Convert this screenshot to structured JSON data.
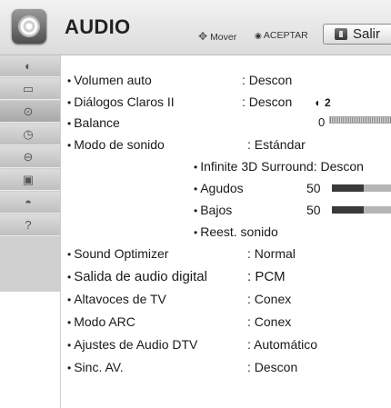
{
  "header": {
    "title": "AUDIO",
    "move_hint": "Mover",
    "ok_hint": "ACEPTAR",
    "exit_label": "Salir",
    "move_icon": "four-way-arrows-icon",
    "ok_icon": "ok-dot-icon",
    "exit_icon": "exit-icon"
  },
  "sidebar": {
    "items": [
      {
        "icon": "picture-disc-icon"
      },
      {
        "icon": "tv-icon"
      },
      {
        "icon": "audio-disc-icon",
        "active": true
      },
      {
        "icon": "clock-icon"
      },
      {
        "icon": "lock-icon"
      },
      {
        "icon": "options-icon"
      },
      {
        "icon": "network-icon"
      },
      {
        "icon": "help-icon"
      }
    ]
  },
  "settings": {
    "volumen_auto": {
      "label": "Volumen auto",
      "value": ": Descon"
    },
    "dialogos": {
      "label": "Diálogos Claros II",
      "value": ": Descon",
      "level": "2"
    },
    "balance": {
      "label": "Balance",
      "value": "0"
    },
    "modo_sonido": {
      "label": "Modo de sonido",
      "value": ": Estándar"
    },
    "infinite": {
      "label": "Infinite 3D Surround: Descon"
    },
    "agudos": {
      "label": "Agudos",
      "value": "50",
      "level": 0.5
    },
    "bajos": {
      "label": "Bajos",
      "value": "50",
      "level": 0.5
    },
    "reest": {
      "label": "Reest. sonido"
    },
    "sound_optimizer": {
      "label": "Sound Optimizer",
      "value": ": Normal"
    },
    "salida_digital": {
      "label": "Salida de audio digital",
      "value": ": PCM"
    },
    "altavoces": {
      "label": "Altavoces de TV",
      "value": ": Conex"
    },
    "modo_arc": {
      "label": "Modo ARC",
      "value": ": Conex"
    },
    "ajustes_dtv": {
      "label": "Ajustes de Audio DTV",
      "value": ": Automático"
    },
    "sinc_av": {
      "label": "Sinc. AV.",
      "value": ": Descon"
    }
  },
  "colors": {
    "bar_fill": "#3a3a3a",
    "bar_rest": "#b5b5b5",
    "sidebar_bg": "#cfcfcf"
  }
}
